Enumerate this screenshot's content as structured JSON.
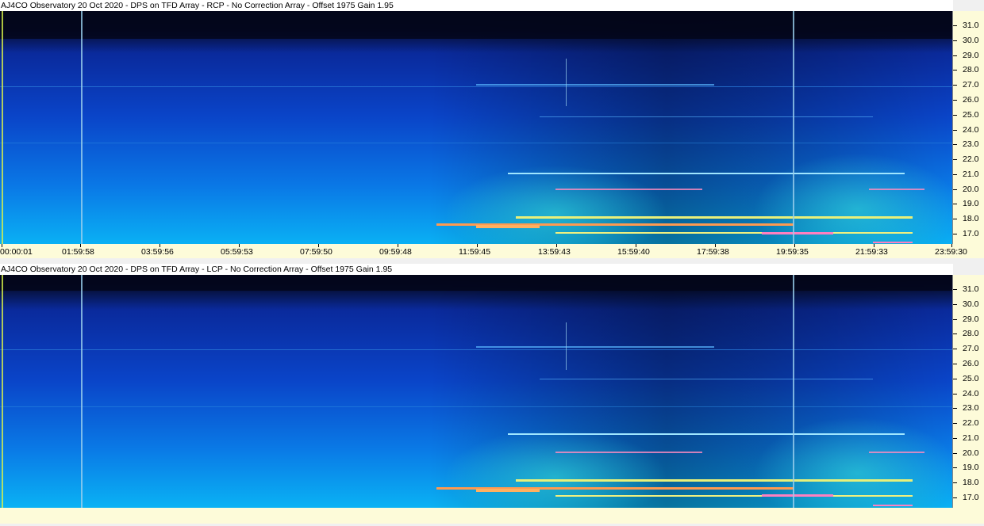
{
  "panels": [
    {
      "title": "AJ4CO Observatory 20 Oct 2020 - DPS on TFD Array  - RCP  -  No Correction Array  -  Offset 1975  Gain 1.95"
    },
    {
      "title": "AJ4CO Observatory 20 Oct 2020 - DPS on TFD Array  - LCP  -  No Correction Array  -  Offset 1975  Gain 1.95"
    }
  ],
  "y_axis_labels": [
    "31.0",
    "30.0",
    "29.0",
    "28.0",
    "27.0",
    "26.0",
    "25.0",
    "24.0",
    "23.0",
    "22.0",
    "21.0",
    "20.0",
    "19.0",
    "18.0",
    "17.0"
  ],
  "x_axis_labels": [
    "00:00:01",
    "01:59:58",
    "03:59:56",
    "05:59:53",
    "07:59:50",
    "09:59:48",
    "11:59:45",
    "13:59:43",
    "15:59:40",
    "17:59:38",
    "19:59:35",
    "21:59:33",
    "23:59:30"
  ],
  "colors": {
    "axis_bg": "#fdfbd9",
    "deep": "#05091c",
    "mid": "#0a3fbe",
    "low": "#0aa4f0"
  }
}
